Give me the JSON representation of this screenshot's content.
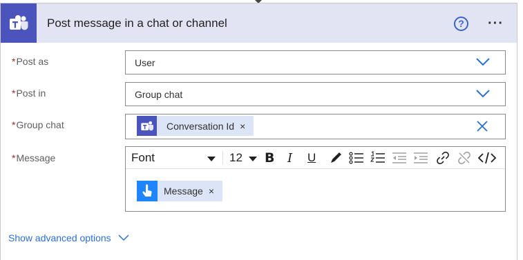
{
  "action": {
    "title": "Post message in a chat or channel",
    "help_icon": "question-circle-icon",
    "more_icon": "more-horizontal-icon",
    "help_glyph": "?",
    "more_glyph": "···"
  },
  "colors": {
    "teams_brand": "#4b53bc",
    "header_bg": "#e2e4f4",
    "token_bg": "#dce4f7",
    "link": "#2b6fd6",
    "required": "#a4262c",
    "trigger_icon_bg": "#1f85ff"
  },
  "fields": {
    "post_as": {
      "label": "Post as",
      "required_mark": "*",
      "value": "User"
    },
    "post_in": {
      "label": "Post in",
      "required_mark": "*",
      "value": "Group chat"
    },
    "group_chat": {
      "label": "Group chat",
      "required_mark": "*",
      "token": "Conversation Id",
      "token_remove": "×"
    },
    "message": {
      "label": "Message",
      "required_mark": "*",
      "token": "Message",
      "token_remove": "×"
    }
  },
  "toolbar": {
    "font": "Font",
    "size": "12",
    "bold": "B",
    "italic": "I",
    "underline": "U"
  },
  "advanced": {
    "label": "Show advanced options"
  }
}
